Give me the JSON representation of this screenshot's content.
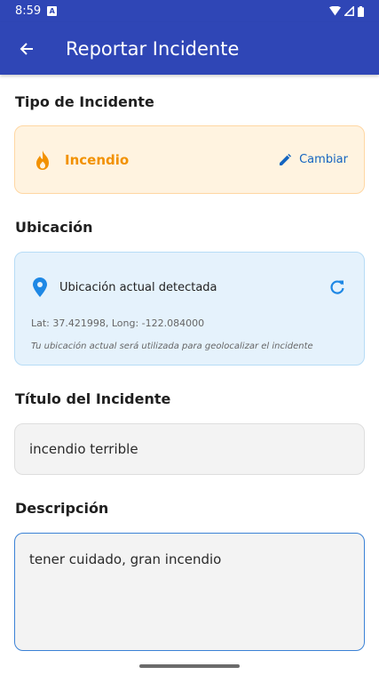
{
  "status_bar": {
    "time": "8:59",
    "notification_icon": "a-icon"
  },
  "app_bar": {
    "title": "Reportar Incidente",
    "back_icon": "arrow-back-icon"
  },
  "incident_type": {
    "label": "Tipo de Incidente",
    "selected": "Incendio",
    "change_label": "Cambiar",
    "accent_color": "#f29100"
  },
  "location": {
    "label": "Ubicación",
    "status": "Ubicación actual detectada",
    "coordinates": "Lat: 37.421998, Long: -122.084000",
    "note": "Tu ubicación actual será utilizada para geolocalizar el incidente"
  },
  "title_section": {
    "label": "Título del Incidente",
    "value": "incendio terrible"
  },
  "description_section": {
    "label": "Descripción",
    "value": "tener cuidado, gran incendio"
  },
  "colors": {
    "primary": "#2f46b6",
    "link": "#1565c0",
    "info_bg": "#e5f2fc",
    "warn_bg": "#fff3e0"
  }
}
